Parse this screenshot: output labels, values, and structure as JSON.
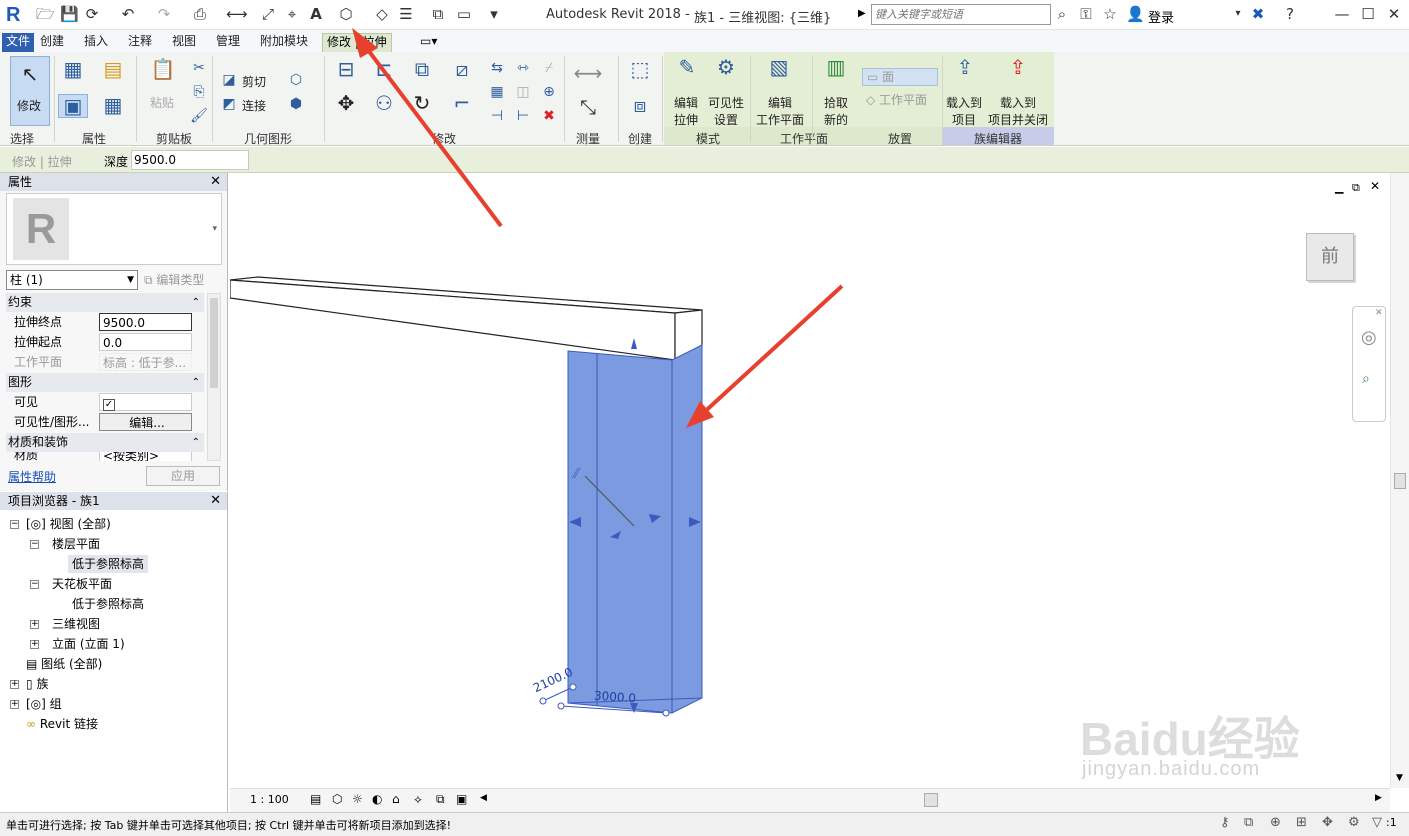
{
  "titlebar": {
    "app_title": "Autodesk Revit 2018 -",
    "doc_title": "族1 - 三维视图: {三维}",
    "search_placeholder": "键入关键字或短语",
    "login_label": "登录"
  },
  "tabs": [
    {
      "label": "文件"
    },
    {
      "label": "创建"
    },
    {
      "label": "插入"
    },
    {
      "label": "注释"
    },
    {
      "label": "视图"
    },
    {
      "label": "管理"
    },
    {
      "label": "附加模块"
    },
    {
      "label": "修改 | 拉伸"
    }
  ],
  "ribbon": {
    "select": {
      "button": "修改",
      "panel": "选择"
    },
    "properties_panel": "属性",
    "clipboard": {
      "paste": "粘贴",
      "panel": "剪贴板"
    },
    "geometry": {
      "cut": "剪切",
      "join": "连接",
      "panel": "几何图形"
    },
    "modify_panel": "修改",
    "measure_panel": "测量",
    "create_panel": "创建",
    "mode": {
      "edit_extrusion_1": "编辑",
      "edit_extrusion_2": "拉伸",
      "visibility_1": "可见性",
      "visibility_2": "设置",
      "panel": "模式"
    },
    "workplane": {
      "edit_wp_1": "编辑",
      "edit_wp_2": "工作平面",
      "panel": "工作平面"
    },
    "placement": {
      "pick_1": "拾取",
      "pick_2": "新的",
      "face": "面",
      "work_plane": "工作平面",
      "panel": "放置"
    },
    "family_editor": {
      "load_1": "载入到",
      "load_2": "项目",
      "load_close_1": "载入到",
      "load_close_2": "项目并关闭",
      "panel": "族编辑器"
    }
  },
  "options_bar": {
    "context": "修改 | 拉伸",
    "depth_label": "深度",
    "depth_value": "9500.0"
  },
  "properties": {
    "title": "属性",
    "type_selector": "柱 (1)",
    "edit_type": "编辑类型",
    "groups": [
      {
        "name": "约束",
        "rows": [
          {
            "label": "拉伸终点",
            "value": "9500.0"
          },
          {
            "label": "拉伸起点",
            "value": "0.0"
          },
          {
            "label": "工作平面",
            "value": "标高 : 低于参..."
          }
        ]
      },
      {
        "name": "图形",
        "rows": [
          {
            "label": "可见",
            "value": "✓"
          },
          {
            "label": "可见性/图形...",
            "value": "编辑..."
          }
        ]
      },
      {
        "name": "材质和装饰",
        "rows": [
          {
            "label": "材质",
            "value": "<按类别>"
          }
        ]
      }
    ],
    "help_link": "属性帮助",
    "apply": "应用"
  },
  "project_browser": {
    "title": "项目浏览器 - 族1",
    "items": [
      {
        "label": "视图 (全部)"
      },
      {
        "label": "楼层平面"
      },
      {
        "label": "低于参照标高"
      },
      {
        "label": "天花板平面"
      },
      {
        "label": "低于参照标高"
      },
      {
        "label": "三维视图"
      },
      {
        "label": "立面 (立面 1)"
      },
      {
        "label": "图纸 (全部)"
      },
      {
        "label": "族"
      },
      {
        "label": "组"
      },
      {
        "label": "Revit 链接"
      }
    ]
  },
  "viewport": {
    "viewcube_face": "前",
    "dim_1": "2100.0",
    "dim_2": "3000.0",
    "scale": "1 : 100",
    "watermark_1": "Baidu经验",
    "watermark_2": "jingyan.baidu.com",
    "colors": {
      "selection": "#7b9ae0",
      "arrow": "#e8402f",
      "edge": "#3a5bbd"
    }
  },
  "status": {
    "message": "单击可进行选择; 按 Tab 键并单击可选择其他项目; 按 Ctrl 键并单击可将新项目添加到选择!",
    "filter_count": ":1"
  }
}
